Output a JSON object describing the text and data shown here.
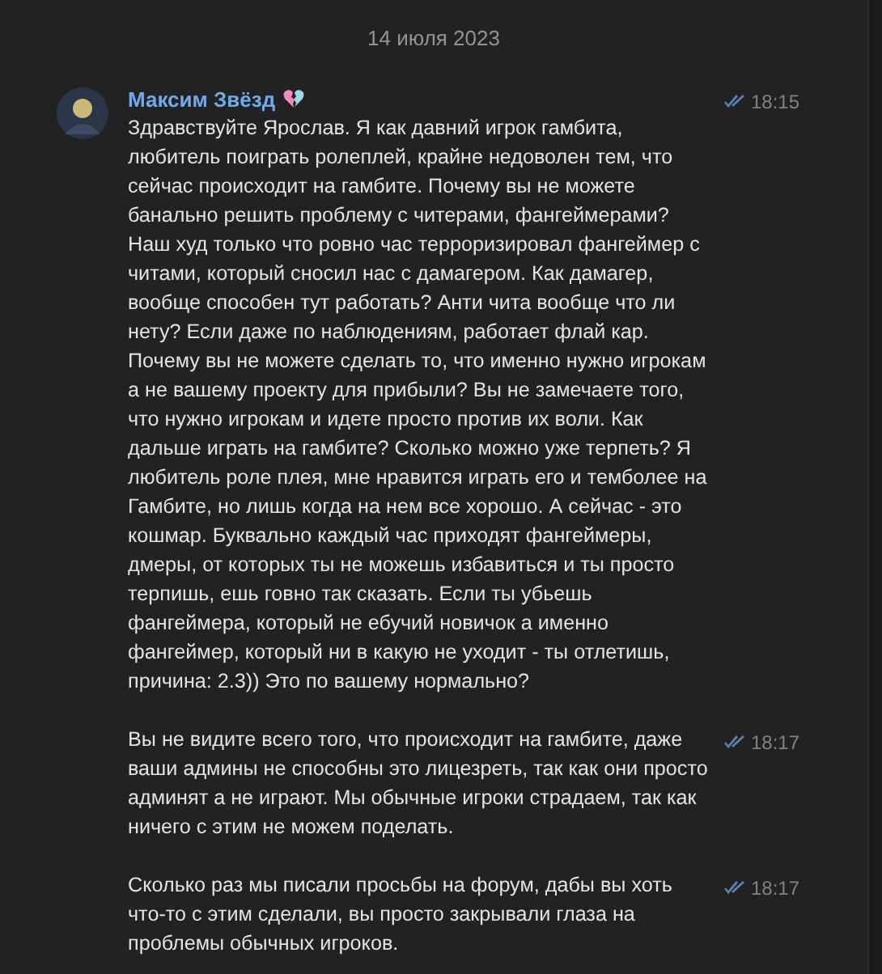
{
  "date": "14 июля 2023",
  "author": {
    "name": "Максим Звёзд"
  },
  "messages": [
    {
      "text": "Здравствуйте Ярослав. Я как давний игрок гамбита, любитель поиграть ролеплей, крайне недоволен тем, что сейчас происходит на гамбите. Почему вы не можете банально решить проблему с читерами, фангеймерами? Наш худ только что ровно час терроризировал фангеймер с читами, который сносил нас с дамагером. Как дамагер, вообще способен тут работать? Анти чита вообще что ли нету? Если даже по наблюдениям, работает флай кар. Почему вы не можете сделать то, что именно нужно игрокам а не вашему проекту для прибыли? Вы не замечаете того, что нужно игрокам и идете просто против их воли. Как дальше играть на гамбите? Сколько можно уже терпеть? Я любитель роле плея, мне нравится играть его и темболее на Гамбите, но лишь когда на нем все хорошо. А сейчас - это кошмар. Буквально каждый час приходят фангеймеры, дмеры, от которых ты не можешь избавиться и ты просто терпишь, ешь говно так сказать. Если ты убьешь фангеймера, который не ебучий новичок а именно фангеймер, который ни в какую не уходит - ты отлетишь, причина: 2.3)) Это по вашему нормально?",
      "time": "18:15"
    },
    {
      "text": "Вы не видите всего того, что происходит на гамбите, даже ваши админы не способны это лицезреть, так как они просто админят а не играют. Мы обычные игроки страдаем, так как ничего с этим не можем поделать.",
      "time": "18:17"
    },
    {
      "text": "Сколько раз мы писали просьбы на форум, дабы вы хоть что-то с этим сделали, вы просто закрывали глаза на проблемы обычных игроков.",
      "time": "18:17"
    }
  ]
}
